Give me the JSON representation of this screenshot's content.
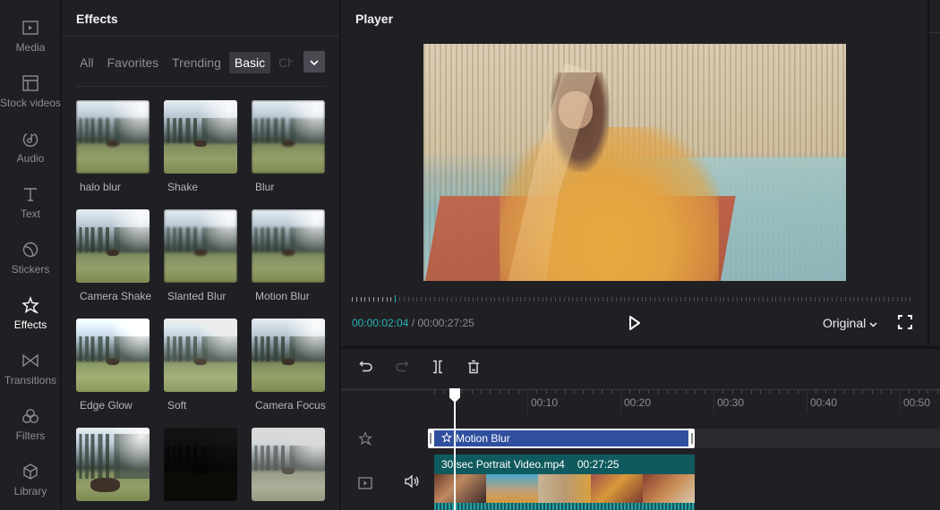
{
  "sidebar": {
    "items": [
      {
        "label": "Media",
        "icon": "media-icon",
        "active": false
      },
      {
        "label": "Stock videos",
        "icon": "stock-videos-icon",
        "active": false
      },
      {
        "label": "Audio",
        "icon": "audio-icon",
        "active": false
      },
      {
        "label": "Text",
        "icon": "text-icon",
        "active": false
      },
      {
        "label": "Stickers",
        "icon": "stickers-icon",
        "active": false
      },
      {
        "label": "Effects",
        "icon": "effects-icon",
        "active": true
      },
      {
        "label": "Transitions",
        "icon": "transitions-icon",
        "active": false
      },
      {
        "label": "Filters",
        "icon": "filters-icon",
        "active": false
      },
      {
        "label": "Library",
        "icon": "library-icon",
        "active": false
      }
    ]
  },
  "effects_panel": {
    "title": "Effects",
    "tabs": [
      {
        "label": "All",
        "active": false
      },
      {
        "label": "Favorites",
        "active": false
      },
      {
        "label": "Trending",
        "active": false
      },
      {
        "label": "Basic",
        "active": true
      },
      {
        "label": "Ch",
        "active": false
      }
    ],
    "more_icon": "chevron-down-icon",
    "items": [
      {
        "name": "halo blur"
      },
      {
        "name": "Shake"
      },
      {
        "name": "Blur"
      },
      {
        "name": "Camera Shake"
      },
      {
        "name": "Slanted Blur"
      },
      {
        "name": "Motion Blur"
      },
      {
        "name": "Edge Glow"
      },
      {
        "name": "Soft"
      },
      {
        "name": "Camera Focus"
      },
      {
        "name": ""
      },
      {
        "name": ""
      },
      {
        "name": ""
      }
    ]
  },
  "player": {
    "title": "Player",
    "current_time": "00:00:02:04",
    "separator": "/",
    "total_time": "00:00:27:25",
    "progress_fraction": 0.075,
    "ratio_label": "Original",
    "play_icon": "play-icon",
    "fullscreen_icon": "fullscreen-icon"
  },
  "timeline": {
    "tools": [
      "undo-icon",
      "redo-icon",
      "split-icon",
      "delete-icon"
    ],
    "ruler_labels": [
      "00:10",
      "00:20",
      "00:30",
      "00:40",
      "00:50"
    ],
    "effect_clip": {
      "label": "Motion Blur",
      "icon": "effects-icon"
    },
    "video_clip": {
      "name": "30 sec Portrait Video.mp4",
      "duration": "00:27:25"
    }
  },
  "colors": {
    "accent_teal": "#27b3b8",
    "effect_clip_blue": "#2f4f9e",
    "video_clip_teal": "#0f5a5e",
    "panel_bg": "#202024"
  }
}
